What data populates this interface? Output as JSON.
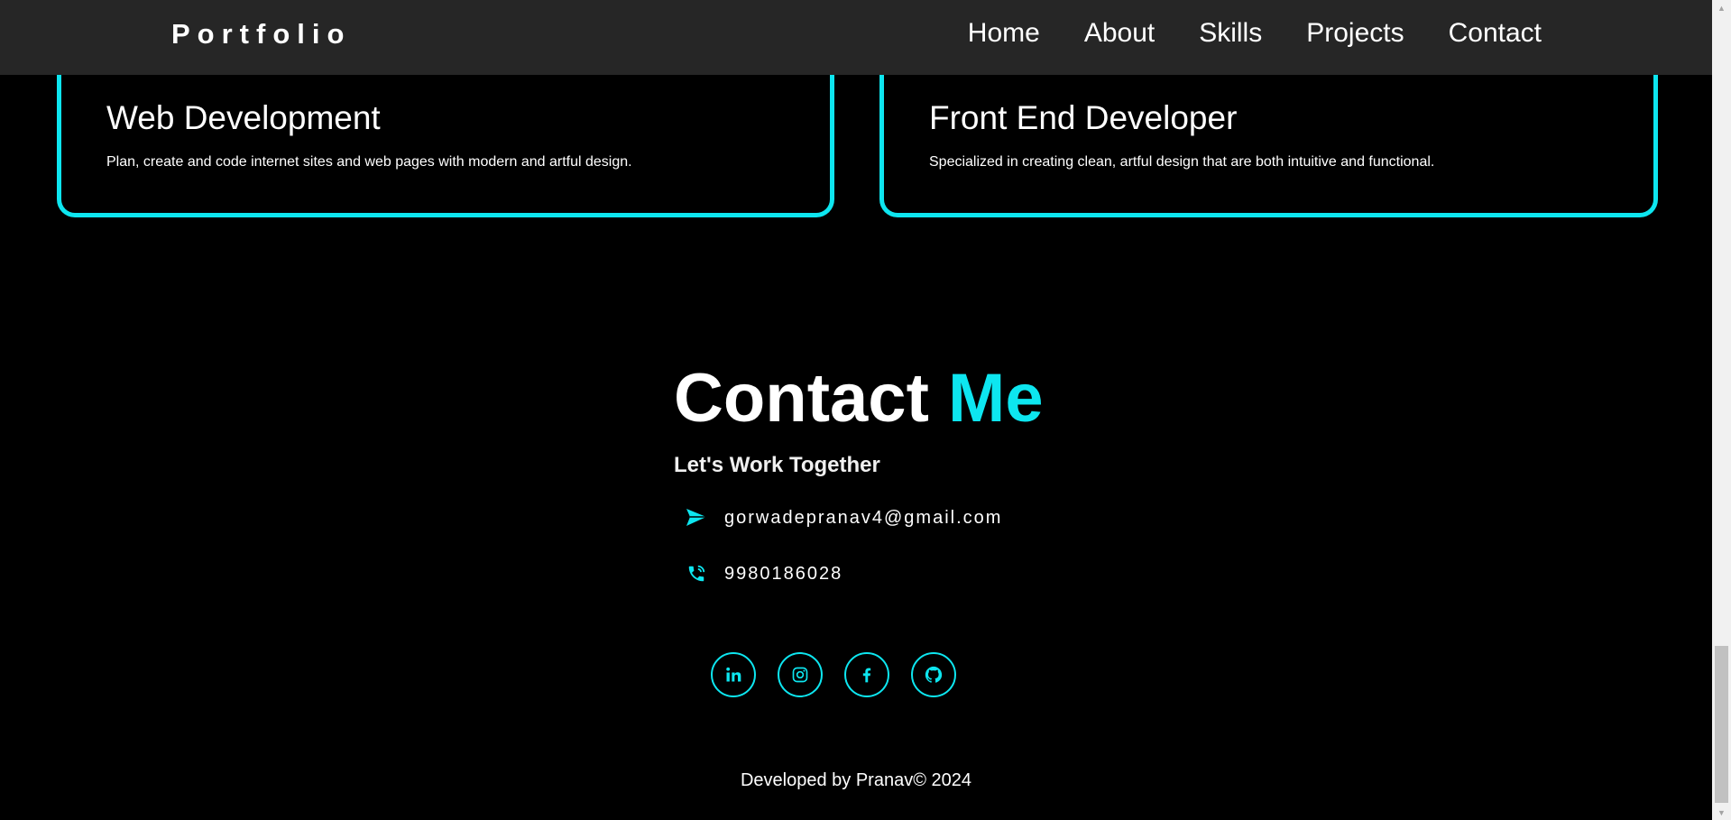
{
  "nav": {
    "brand": "Portfolio",
    "links": [
      "Home",
      "About",
      "Skills",
      "Projects",
      "Contact"
    ]
  },
  "services": [
    {
      "title": "Web Development",
      "description": "Plan, create and code internet sites and web pages with modern and artful design."
    },
    {
      "title": "Front End Developer",
      "description": "Specialized in creating clean, artful design that are both intuitive and functional."
    }
  ],
  "contact": {
    "title_main": "Contact",
    "title_accent": "Me",
    "subtitle": "Let's Work Together",
    "email": "gorwadepranav4@gmail.com",
    "email_icon": "paper-plane-icon",
    "phone": "9980186028",
    "phone_icon": "phone-icon"
  },
  "socials": [
    "linkedin-icon",
    "instagram-icon",
    "facebook-icon",
    "github-icon"
  ],
  "footer": {
    "text": "Developed by Pranav© 2024"
  },
  "colors": {
    "accent": "#0de6f0",
    "background": "#000000",
    "navbar": "#262626"
  }
}
